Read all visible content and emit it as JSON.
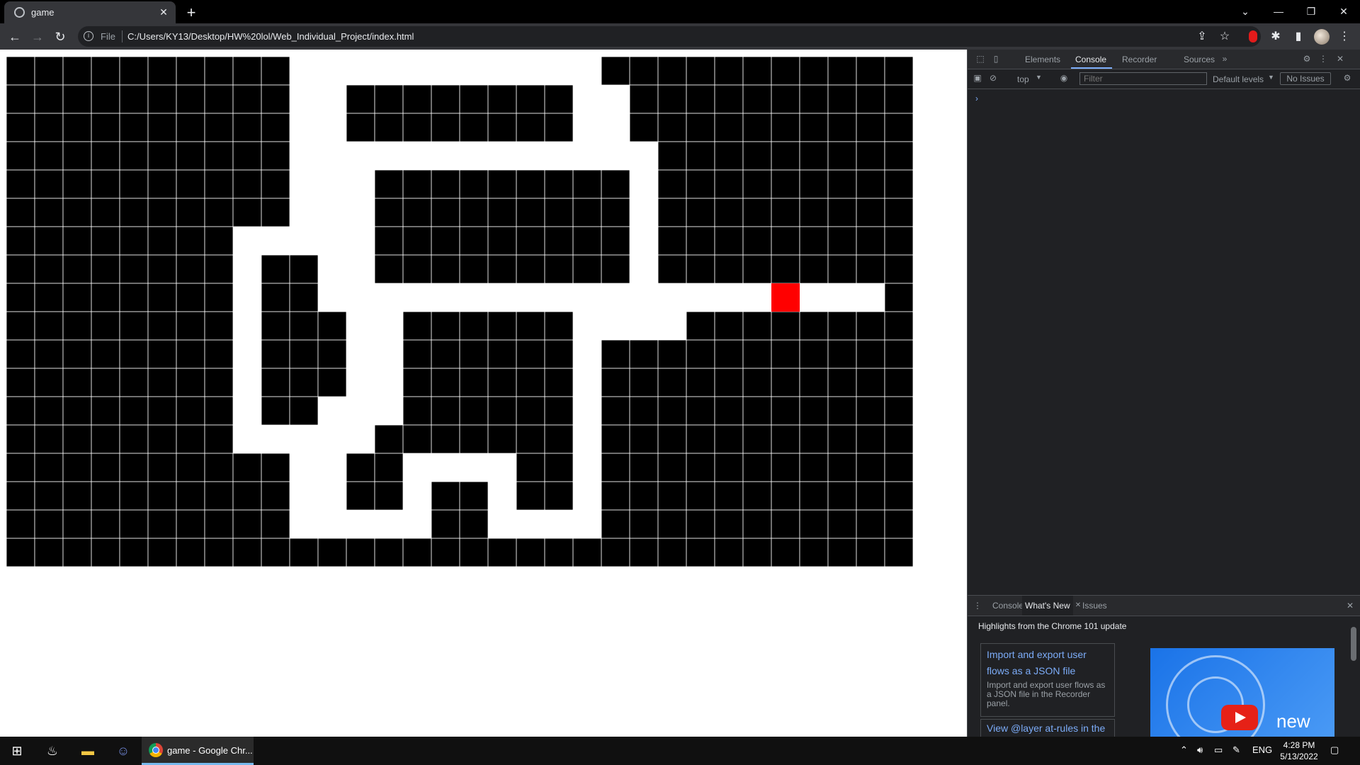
{
  "browser": {
    "tab_title": "game",
    "url_scheme": "File",
    "url": "C:/Users/KY13/Desktop/HW%20lol/Web_Individual_Project/index.html"
  },
  "maze": {
    "cols": 32,
    "rows": 18,
    "wall_color": "#000000",
    "path_color": "#ffffff",
    "grid_line_color": "#ffffff",
    "player_color": "#ff0000",
    "player": [
      27,
      8
    ],
    "grid": [
      "1111111111000000000001111111111",
      "1111111111001111111100111111111",
      "1111111111001111111100111111111",
      "1111111111000000000000011111111",
      "1111111111000111111111011111111",
      "1111111111000111111111011111111",
      "1111111100000111111111011111111",
      "1111111101100111111111011111111",
      "1111111101100000000000000000000",
      "1111111101110011111100001111111",
      "1111111101110011111101111111111",
      "1111111101110011111101111111111",
      "1111111101100011111101111111111",
      "1111111100000111111101111111111",
      "1111111111001100001101111111111",
      "1111111111001101101101111111111",
      "1111111111000001100001111111111",
      "1111111111111111111111111111111"
    ]
  },
  "devtools": {
    "tabs": [
      "Elements",
      "Console",
      "Recorder",
      "Sources"
    ],
    "active_tab": "Console",
    "context": "top",
    "filter_placeholder": "Filter",
    "levels": "Default levels",
    "issues": "No Issues",
    "prompt": "›",
    "drawer": {
      "tabs": [
        "Console",
        "What's New",
        "Issues"
      ],
      "active_tab": "What's New",
      "heading": "Highlights from the Chrome 101 update",
      "card1_title": "Import and export user flows as a JSON file",
      "card1_desc": "Import and export user flows as a JSON file in the Recorder panel.",
      "card2_title": "View @layer at-rules in the",
      "video_text": "new"
    }
  },
  "taskbar": {
    "active_app": "game - Google Chr...",
    "lang": "ENG",
    "time": "4:28 PM",
    "date": "5/13/2022"
  }
}
